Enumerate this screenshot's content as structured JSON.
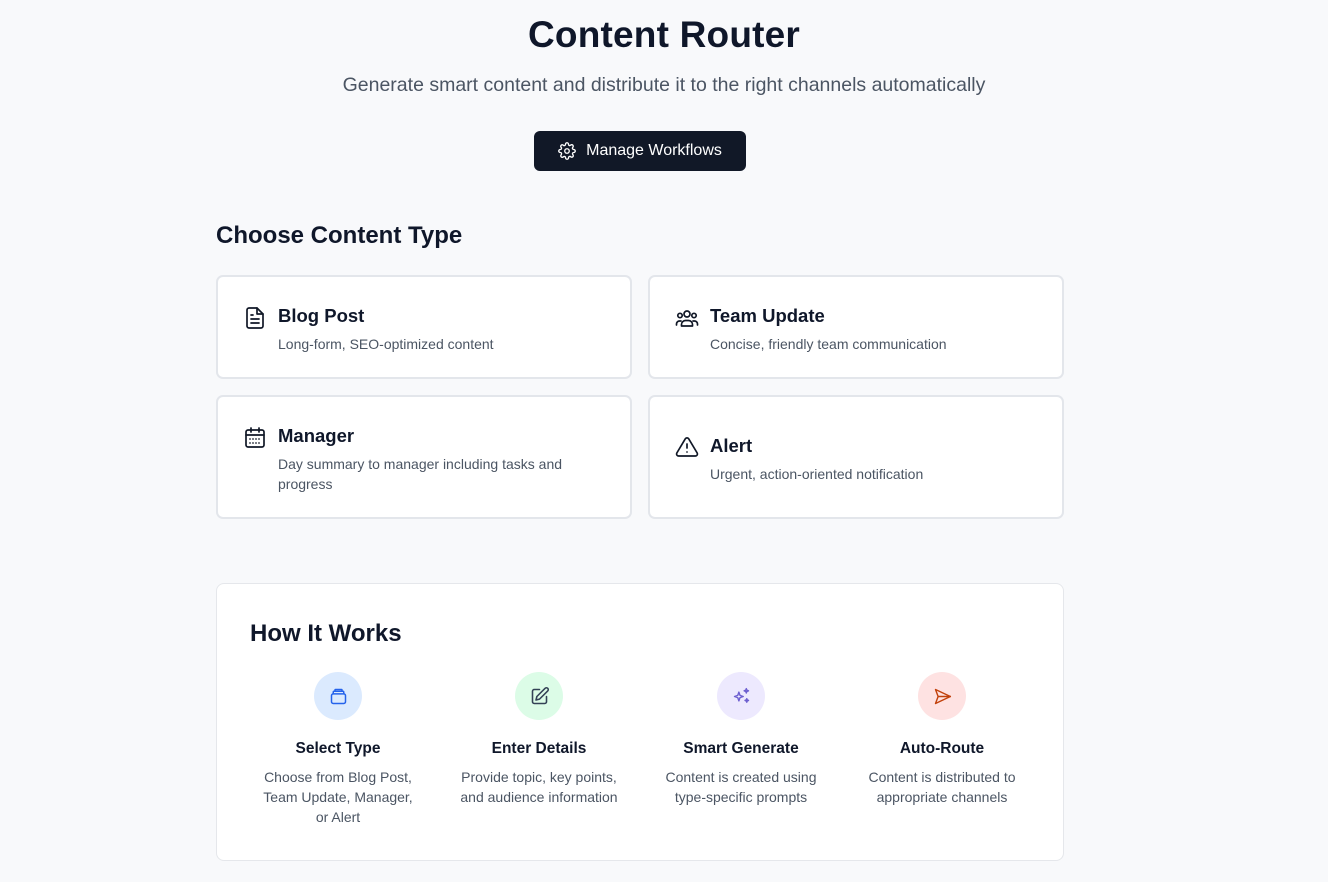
{
  "header": {
    "title": "Content Router",
    "subtitle": "Generate smart content and distribute it to the right channels automatically",
    "manage_button_label": "Manage Workflows"
  },
  "content_types": {
    "section_title": "Choose Content Type",
    "items": [
      {
        "icon": "document-icon",
        "title": "Blog Post",
        "description": "Long-form, SEO-optimized content"
      },
      {
        "icon": "users-icon",
        "title": "Team Update",
        "description": "Concise, friendly team communication"
      },
      {
        "icon": "calendar-icon",
        "title": "Manager",
        "description": "Day summary to manager including tasks and progress"
      },
      {
        "icon": "warning-icon",
        "title": "Alert",
        "description": "Urgent, action-oriented notification"
      }
    ]
  },
  "how_it_works": {
    "title": "How It Works",
    "steps": [
      {
        "icon": "stack-icon",
        "title": "Select Type",
        "description": "Choose from Blog Post, Team Update, Manager, or Alert",
        "circle_color": "#dbeafe",
        "icon_color": "#2563eb"
      },
      {
        "icon": "edit-icon",
        "title": "Enter Details",
        "description": "Provide topic, key points, and audience information",
        "circle_color": "#dcfce7",
        "icon_color": "#334155"
      },
      {
        "icon": "sparkles-icon",
        "title": "Smart Generate",
        "description": "Content is created using type-specific prompts",
        "circle_color": "#ede9fe",
        "icon_color": "#6d5fd0"
      },
      {
        "icon": "send-icon",
        "title": "Auto-Route",
        "description": "Content is distributed to appropriate channels",
        "circle_color": "#fee2e2",
        "icon_color": "#c2410c"
      }
    ]
  },
  "colors": {
    "background": "#f8f9fb",
    "primary_button": "#111827",
    "text_primary": "#0f172a",
    "text_secondary": "#4b5563"
  }
}
